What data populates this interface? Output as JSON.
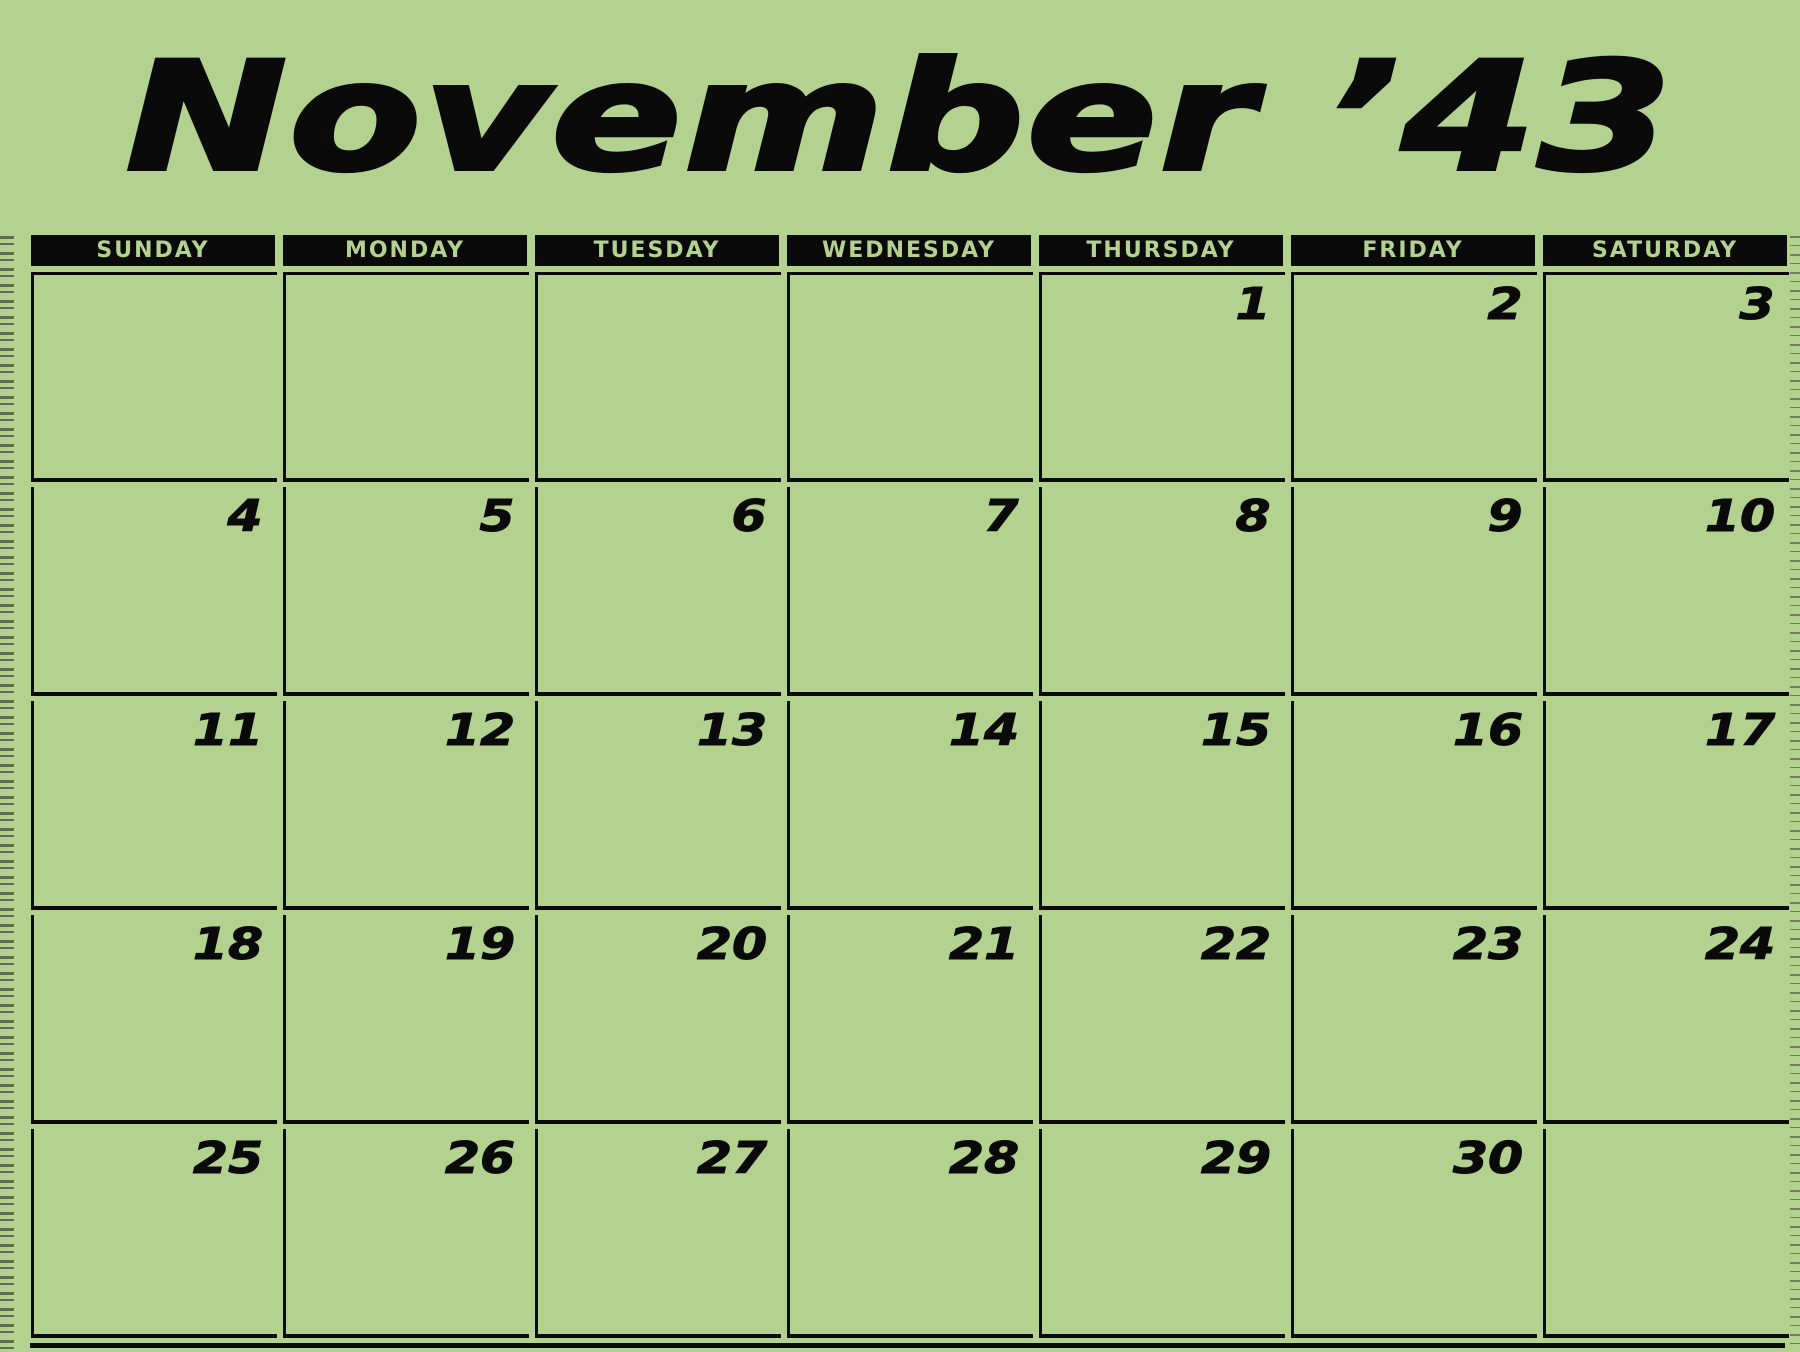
{
  "calendar": {
    "title": "November ’43",
    "weekdays": [
      "SUNDAY",
      "MONDAY",
      "TUESDAY",
      "WEDNESDAY",
      "THURSDAY",
      "FRIDAY",
      "SATURDAY"
    ],
    "weeks": [
      [
        "",
        "",
        "",
        "",
        "1",
        "2",
        "3"
      ],
      [
        "4",
        "5",
        "6",
        "7",
        "8",
        "9",
        "10"
      ],
      [
        "11",
        "12",
        "13",
        "14",
        "15",
        "16",
        "17"
      ],
      [
        "18",
        "19",
        "20",
        "21",
        "22",
        "23",
        "24"
      ],
      [
        "25",
        "26",
        "27",
        "28",
        "29",
        "30",
        ""
      ]
    ]
  },
  "colors": {
    "background": "#b3d290",
    "ink": "#0a0a0a"
  }
}
